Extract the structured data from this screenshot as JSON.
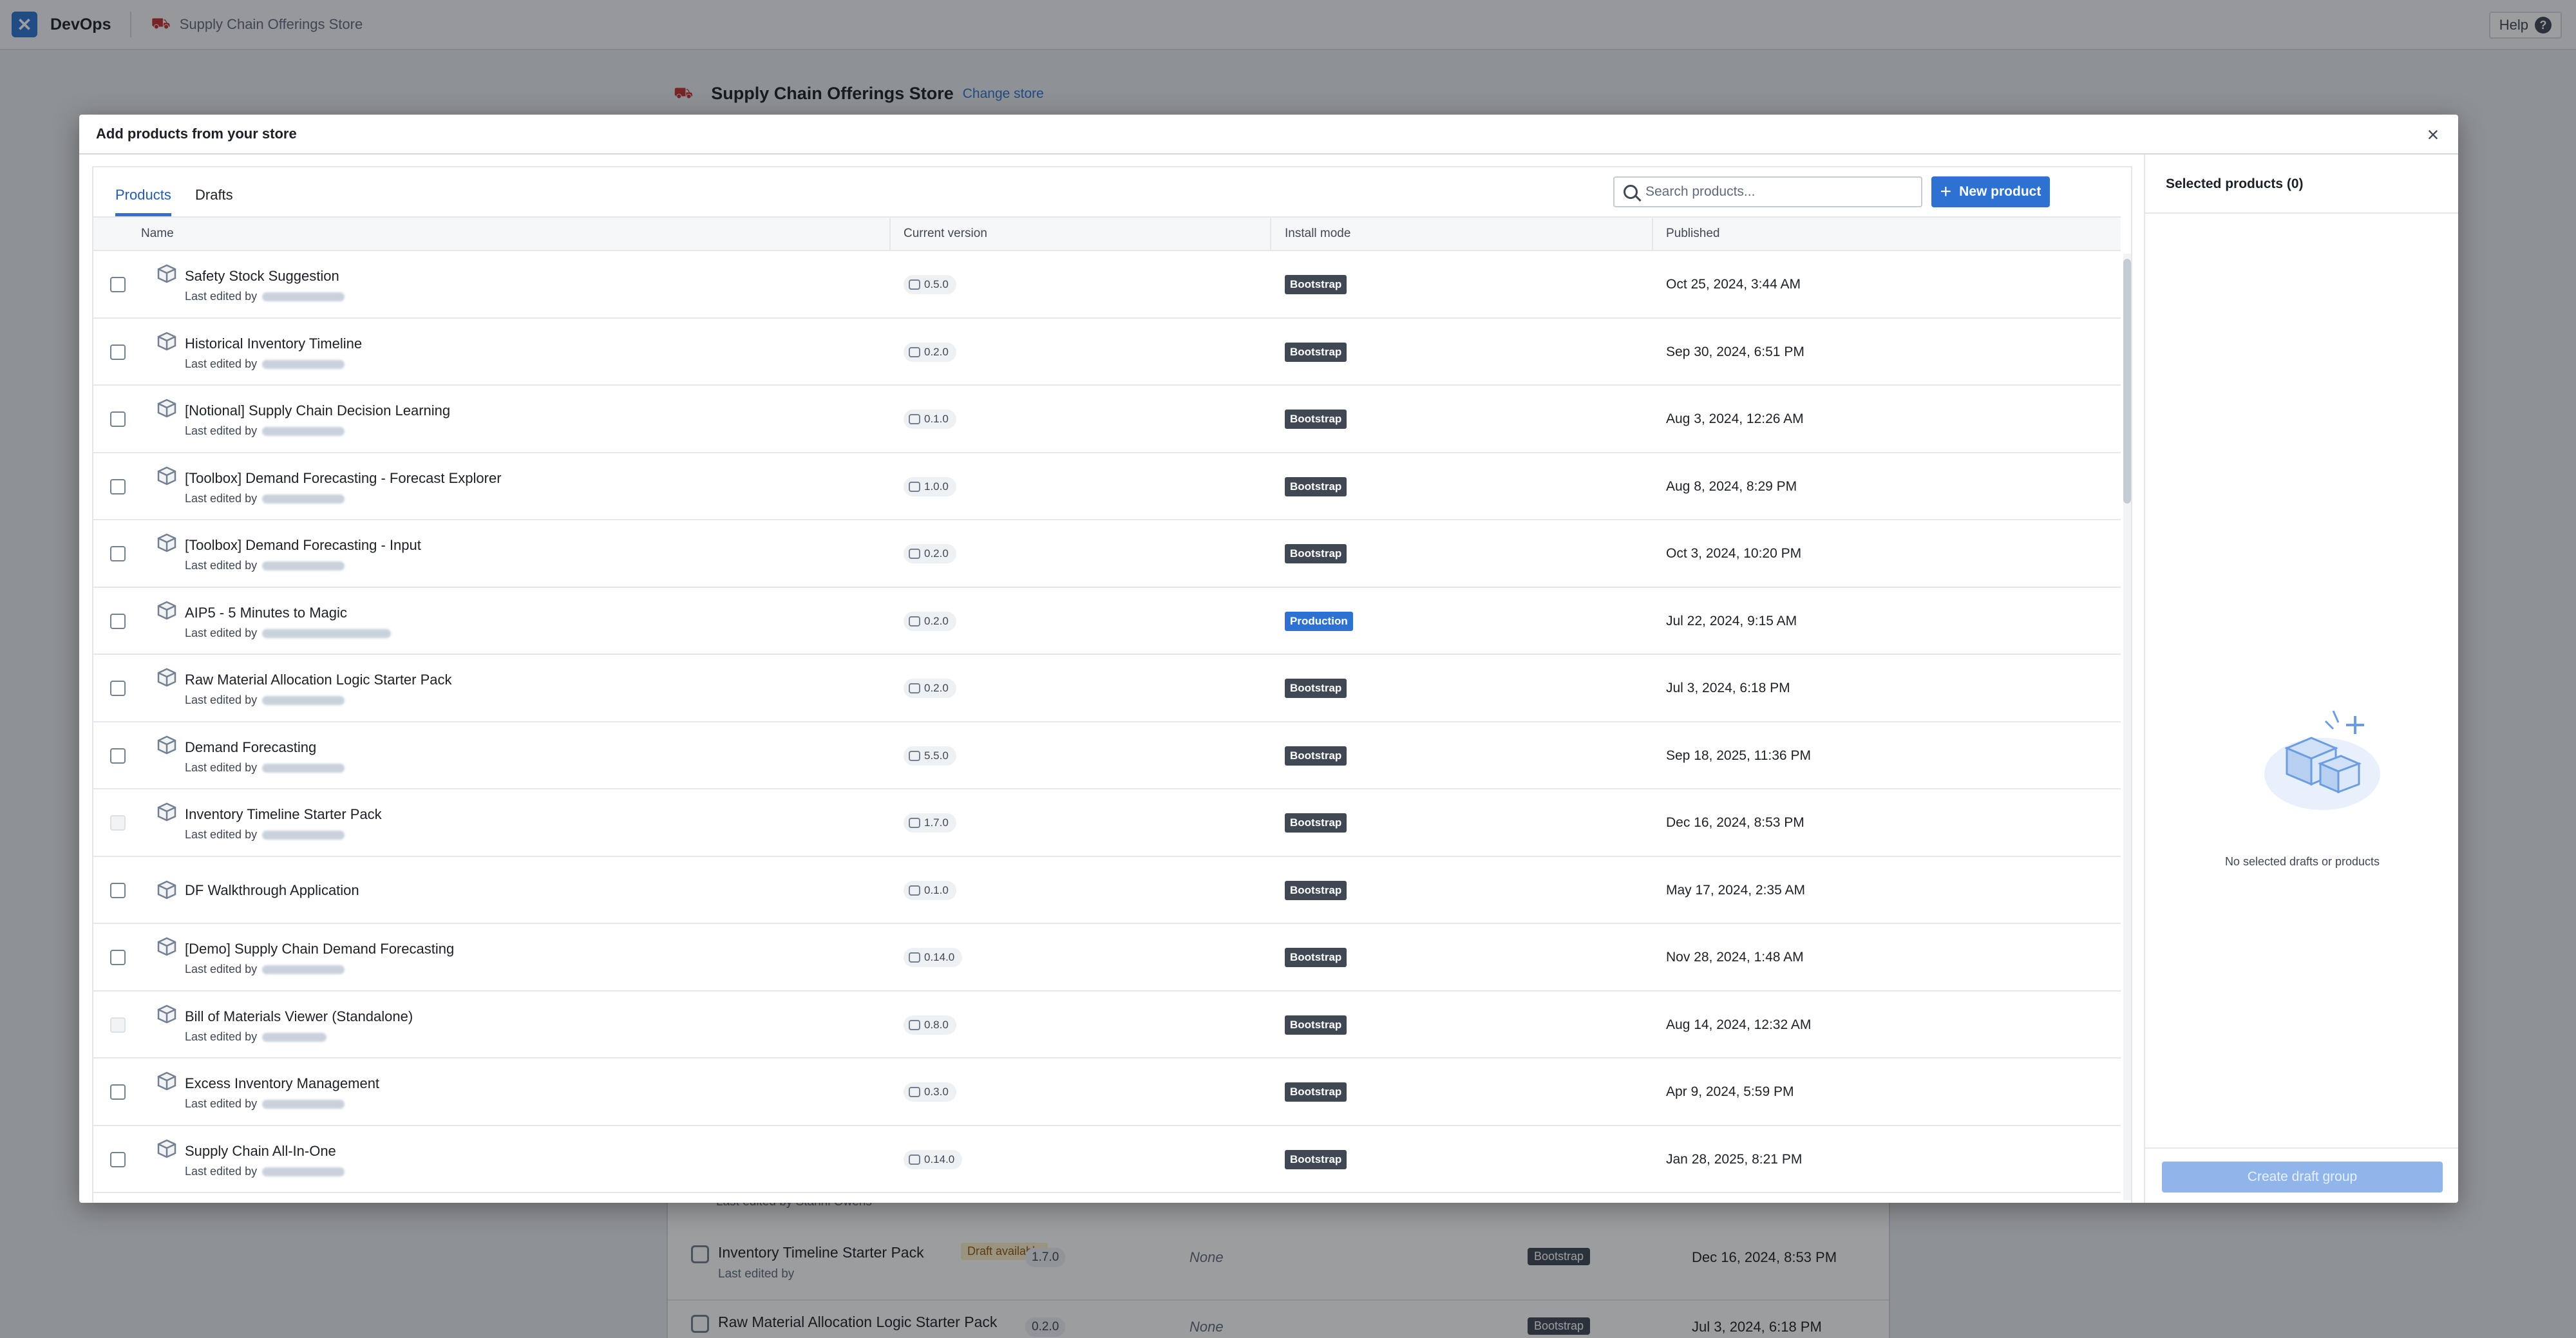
{
  "app": {
    "name": "DevOps",
    "breadcrumb_store": "Supply Chain Offerings Store",
    "help_label": "Help",
    "help_glyph": "?"
  },
  "background": {
    "store_title": "Supply Chain Offerings Store",
    "change_store": "Change store",
    "edited_by_line": "Last edited by Stanni Owens",
    "rows": [
      {
        "name": "Inventory Timeline Starter Pack",
        "draft": "Draft available",
        "edited": "Last edited by",
        "version": "1.7.0",
        "install": "None",
        "mode": "Bootstrap",
        "published": "Dec 16, 2024, 8:53 PM"
      },
      {
        "name": "Raw Material Allocation Logic Starter Pack",
        "draft": "",
        "edited": "Last edited by",
        "version": "0.2.0",
        "install": "None",
        "mode": "Bootstrap",
        "published": "Jul 3, 2024, 6:18 PM"
      }
    ]
  },
  "dialog": {
    "title": "Add products from your store",
    "close_glyph": "×",
    "tabs": [
      {
        "label": "Products"
      },
      {
        "label": "Drafts"
      }
    ],
    "search": {
      "placeholder": "Search products...",
      "value": ""
    },
    "new_product_label": "New product",
    "columns": {
      "name": "Name",
      "version": "Current version",
      "mode": "Install mode",
      "published": "Published"
    },
    "edited_prefix": "Last edited by",
    "rows": [
      {
        "name": "Safety Stock Suggestion",
        "version": "0.5.0",
        "mode": "Bootstrap",
        "published": "Oct 25, 2024, 3:44 AM",
        "enabled": true,
        "has_editor": true
      },
      {
        "name": "Historical Inventory Timeline",
        "version": "0.2.0",
        "mode": "Bootstrap",
        "published": "Sep 30, 2024, 6:51 PM",
        "enabled": true,
        "has_editor": true
      },
      {
        "name": "[Notional] Supply Chain Decision Learning",
        "version": "0.1.0",
        "mode": "Bootstrap",
        "published": "Aug 3, 2024, 12:26 AM",
        "enabled": true,
        "has_editor": true
      },
      {
        "name": "[Toolbox] Demand Forecasting - Forecast Explorer",
        "version": "1.0.0",
        "mode": "Bootstrap",
        "published": "Aug 8, 2024, 8:29 PM",
        "enabled": true,
        "has_editor": true
      },
      {
        "name": "[Toolbox] Demand Forecasting - Input",
        "version": "0.2.0",
        "mode": "Bootstrap",
        "published": "Oct 3, 2024, 10:20 PM",
        "enabled": true,
        "has_editor": true
      },
      {
        "name": "AIP5 - 5 Minutes to Magic",
        "version": "0.2.0",
        "mode": "Production",
        "published": "Jul 22, 2024, 9:15 AM",
        "enabled": true,
        "has_editor": true
      },
      {
        "name": "Raw Material Allocation Logic Starter Pack",
        "version": "0.2.0",
        "mode": "Bootstrap",
        "published": "Jul 3, 2024, 6:18 PM",
        "enabled": true,
        "has_editor": true
      },
      {
        "name": "Demand Forecasting",
        "version": "5.5.0",
        "mode": "Bootstrap",
        "published": "Sep 18, 2025, 11:36 PM",
        "enabled": true,
        "has_editor": true
      },
      {
        "name": "Inventory Timeline Starter Pack",
        "version": "1.7.0",
        "mode": "Bootstrap",
        "published": "Dec 16, 2024, 8:53 PM",
        "enabled": false,
        "has_editor": true
      },
      {
        "name": "DF Walkthrough Application",
        "version": "0.1.0",
        "mode": "Bootstrap",
        "published": "May 17, 2024, 2:35 AM",
        "enabled": true,
        "has_editor": false
      },
      {
        "name": "[Demo] Supply Chain Demand Forecasting",
        "version": "0.14.0",
        "mode": "Bootstrap",
        "published": "Nov 28, 2024, 1:48 AM",
        "enabled": true,
        "has_editor": true
      },
      {
        "name": "Bill of Materials Viewer (Standalone)",
        "version": "0.8.0",
        "mode": "Bootstrap",
        "published": "Aug 14, 2024, 12:32 AM",
        "enabled": false,
        "has_editor": true
      },
      {
        "name": "Excess Inventory Management",
        "version": "0.3.0",
        "mode": "Bootstrap",
        "published": "Apr 9, 2024, 5:59 PM",
        "enabled": true,
        "has_editor": true
      },
      {
        "name": "Supply Chain All-In-One",
        "version": "0.14.0",
        "mode": "Bootstrap",
        "published": "Jan 28, 2025, 8:21 PM",
        "enabled": true,
        "has_editor": true
      }
    ],
    "selected": {
      "title": "Selected products (0)",
      "empty_text": "No selected drafts or products",
      "create_label": "Create draft group"
    }
  },
  "icons": {
    "product": "cube-icon",
    "version": "version-icon",
    "search": "search-icon",
    "close": "close-icon",
    "plus": "plus-icon"
  },
  "colors": {
    "accent": "#2d72d2",
    "bootstrap_tag": "#404854",
    "production_tag": "#2d72d2",
    "disabled_button": "#8fb5ea"
  }
}
